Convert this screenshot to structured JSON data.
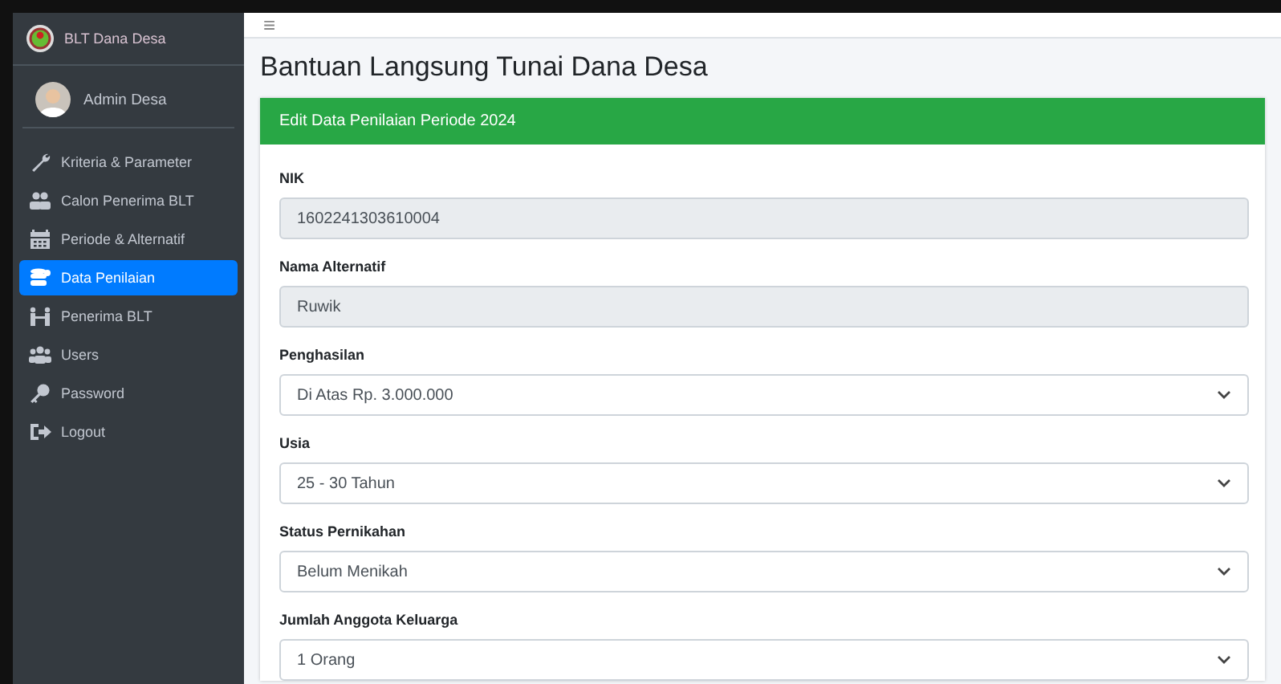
{
  "brand": {
    "title": "BLT Dana Desa"
  },
  "user": {
    "name": "Admin Desa"
  },
  "menu": [
    {
      "label": "Kriteria & Parameter",
      "selected": false
    },
    {
      "label": "Calon Penerima BLT",
      "selected": false
    },
    {
      "label": "Periode & Alternatif",
      "selected": false
    },
    {
      "label": "Data Penilaian",
      "selected": true
    },
    {
      "label": "Penerima BLT",
      "selected": false
    },
    {
      "label": "Users",
      "selected": false
    },
    {
      "label": "Password",
      "selected": false
    },
    {
      "label": "Logout",
      "selected": false
    }
  ],
  "topbar": {
    "menu_glyph": "≡"
  },
  "page_title": "Bantuan Langsung Tunai Dana Desa",
  "card": {
    "header": "Edit Data Penilaian Periode 2024",
    "fields": [
      {
        "label": "NIK",
        "value": "1602241303610004",
        "kind": "readonly"
      },
      {
        "label": "Nama Alternatif",
        "value": "Ruwik",
        "kind": "readonly"
      },
      {
        "label": "Penghasilan",
        "value": "Di Atas Rp. 3.000.000",
        "kind": "select"
      },
      {
        "label": "Usia",
        "value": "25 - 30 Tahun",
        "kind": "select"
      },
      {
        "label": "Status Pernikahan",
        "value": "Belum Menikah",
        "kind": "select"
      },
      {
        "label": "Jumlah Anggota Keluarga",
        "value": "1 Orang",
        "kind": "select"
      }
    ]
  }
}
